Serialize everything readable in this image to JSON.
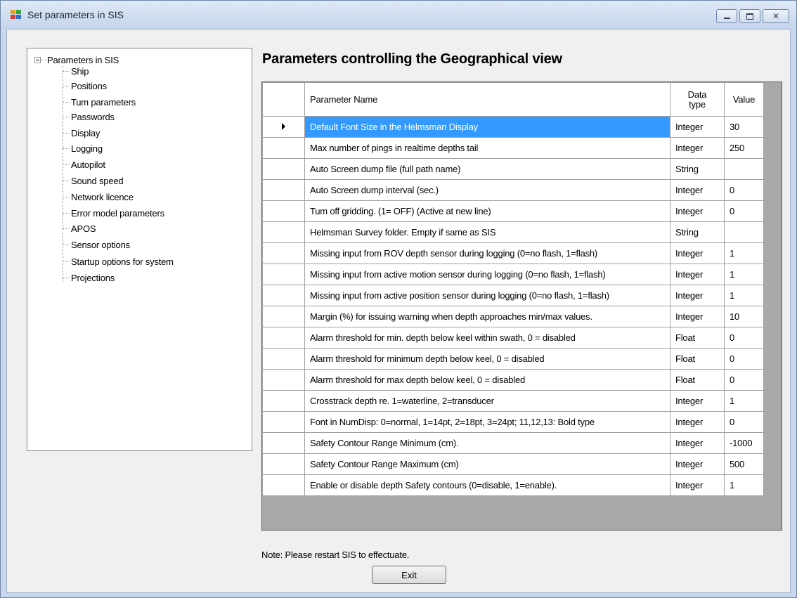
{
  "window": {
    "title": "Set parameters in SIS",
    "controls": [
      "minimize-icon",
      "maximize-icon",
      "close-icon"
    ]
  },
  "tree": {
    "root": "Parameters in SIS",
    "items": [
      "Ship",
      "Positions",
      "Tum parameters",
      "Passwords",
      "Display",
      "Logging",
      "Autopilot",
      "Sound speed",
      "Network licence",
      "Error model parameters",
      "APOS",
      "Sensor options",
      "Startup options for system",
      "Projections"
    ]
  },
  "heading": "Parameters controlling the Geographical view",
  "grid": {
    "columns": {
      "name": "Parameter Name",
      "type_line1": "Data",
      "type_line2": "type",
      "value": "Value"
    },
    "selected_row": 0,
    "rows": [
      {
        "name": "Default Font Size in the Helmsman Display",
        "type": "Integer",
        "value": "30"
      },
      {
        "name": "Max number of pings in realtime depths tail",
        "type": "Integer",
        "value": "250"
      },
      {
        "name": "Auto Screen dump file (full path name)",
        "type": "String",
        "value": ""
      },
      {
        "name": "Auto Screen dump interval (sec.)",
        "type": "Integer",
        "value": "0"
      },
      {
        "name": "Tum off gridding. (1= OFF) (Active at new line)",
        "type": "Integer",
        "value": "0"
      },
      {
        "name": "Helmsman Survey folder. Empty if same as SIS",
        "type": "String",
        "value": ""
      },
      {
        "name": "Missing input from ROV depth sensor during logging (0=no flash, 1=flash)",
        "type": "Integer",
        "value": "1"
      },
      {
        "name": "Missing input from active motion sensor during logging (0=no flash, 1=flash)",
        "type": "Integer",
        "value": "1"
      },
      {
        "name": "Missing input from active position sensor during logging (0=no flash, 1=flash)",
        "type": "Integer",
        "value": "1"
      },
      {
        "name": "Margin (%) for issuing warning when depth approaches min/max values.",
        "type": "Integer",
        "value": "10"
      },
      {
        "name": "Alarm threshold for min. depth below keel within swath, 0 = disabled",
        "type": "Float",
        "value": "0"
      },
      {
        "name": "Alarm threshold for minimum depth below keel, 0 = disabled",
        "type": "Float",
        "value": "0"
      },
      {
        "name": "Alarm threshold for max depth below keel, 0 = disabled",
        "type": "Float",
        "value": "0"
      },
      {
        "name": "Crosstrack depth re. 1=waterline, 2=transducer",
        "type": "Integer",
        "value": "1"
      },
      {
        "name": "Font in NumDisp: 0=normal, 1=14pt, 2=18pt, 3=24pt; 11,12,13: Bold type",
        "type": "Integer",
        "value": "0"
      },
      {
        "name": "Safety Contour Range Minimum (cm).",
        "type": "Integer",
        "value": "-1000"
      },
      {
        "name": "Safety Contour Range Maximum (cm)",
        "type": "Integer",
        "value": "500"
      },
      {
        "name": "Enable or disable depth Safety contours (0=disable, 1=enable).",
        "type": "Integer",
        "value": "1"
      }
    ]
  },
  "footer": {
    "note": "Note: Please restart SIS to effectuate.",
    "exit_label": "Exit"
  },
  "colors": {
    "selection": "#3399ff",
    "grid_background": "#a8a8a8",
    "window_frame": "#c9d8ec"
  }
}
